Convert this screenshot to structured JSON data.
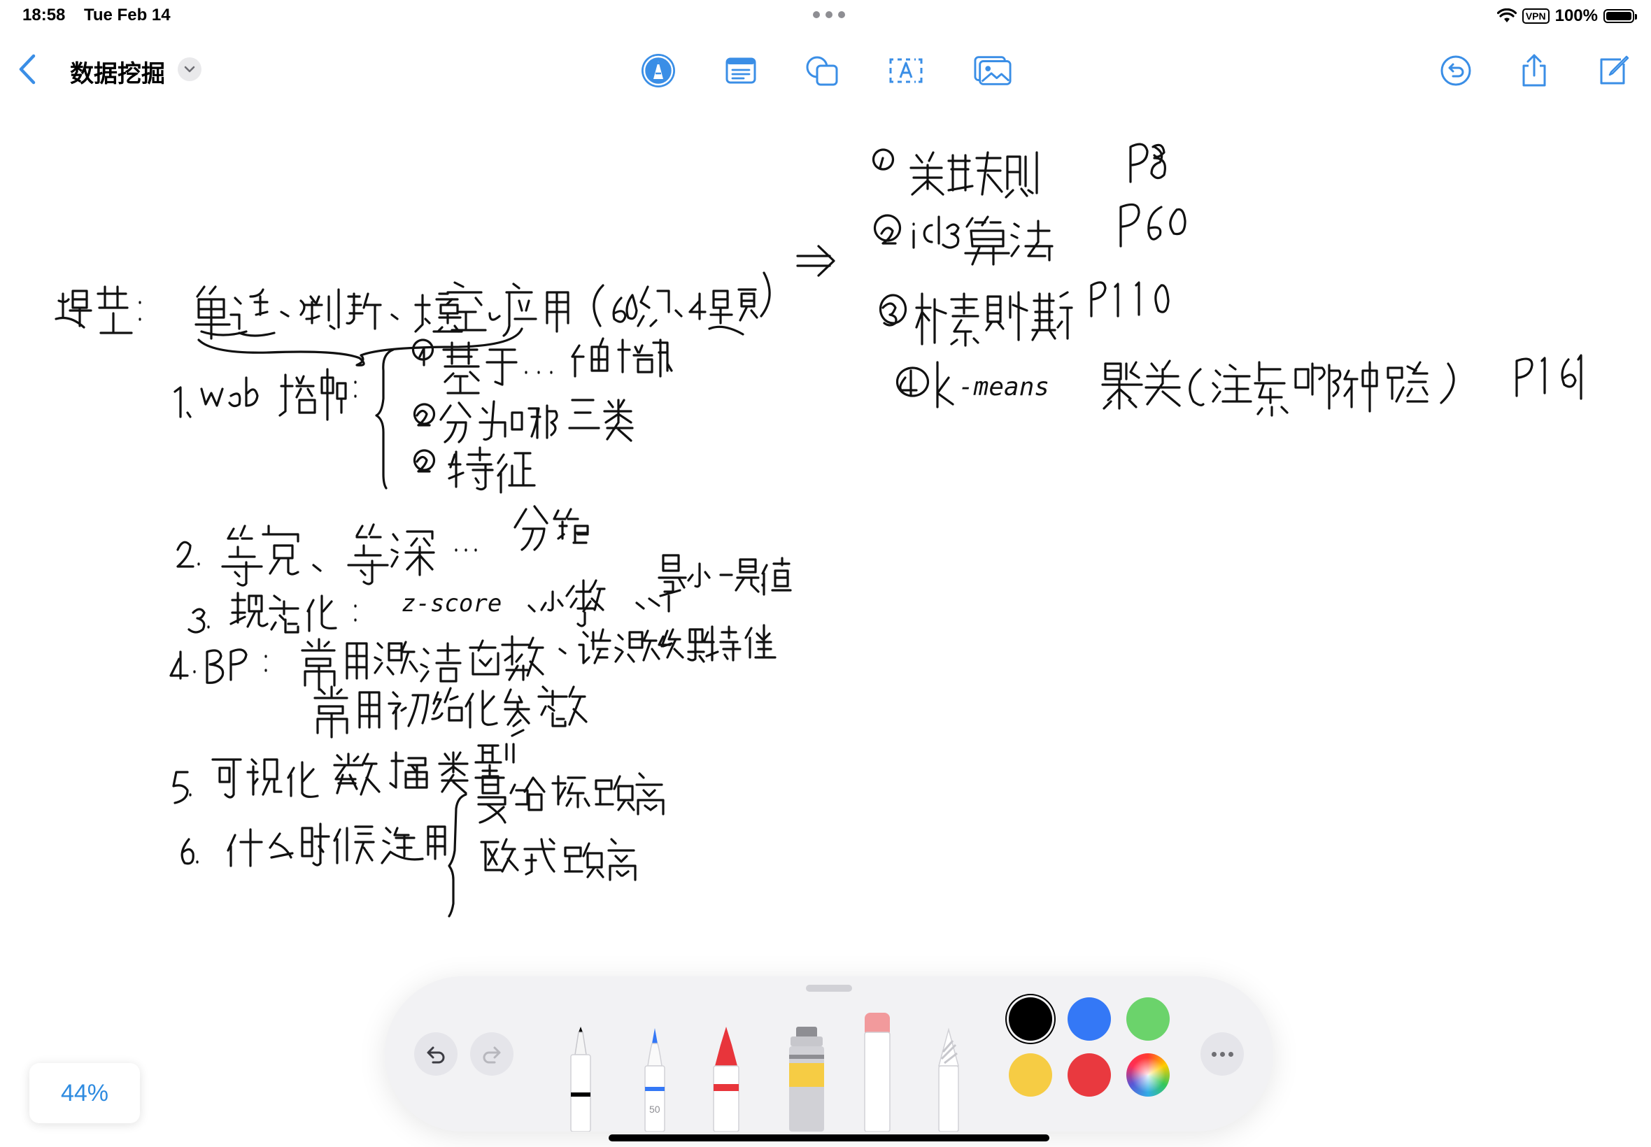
{
  "status_bar": {
    "time": "18:58",
    "date": "Tue Feb 14",
    "vpn": "VPN",
    "battery": "100%",
    "battery_level": 1.0
  },
  "toolbar": {
    "document_title": "数据挖掘",
    "icons": [
      "back-chevron-icon",
      "title-menu-chevron-icon",
      "markup-pen-icon",
      "text-box-icon",
      "shapes-icon",
      "text-field-icon",
      "insert-image-icon",
      "undo-history-icon",
      "share-icon",
      "compose-icon"
    ],
    "accent": "#3a8ee6"
  },
  "palette": {
    "pen_size_label": "50",
    "tools": [
      "fineliner",
      "pen",
      "marker",
      "watercolor",
      "eraser",
      "pencil"
    ],
    "colors": [
      "#000000",
      "#3478f6",
      "#6bd36b",
      "#f6cc44",
      "#e9393f"
    ],
    "selected_color": "#000000",
    "more_icon": "ellipsis-icon"
  },
  "zoom": "44%"
}
